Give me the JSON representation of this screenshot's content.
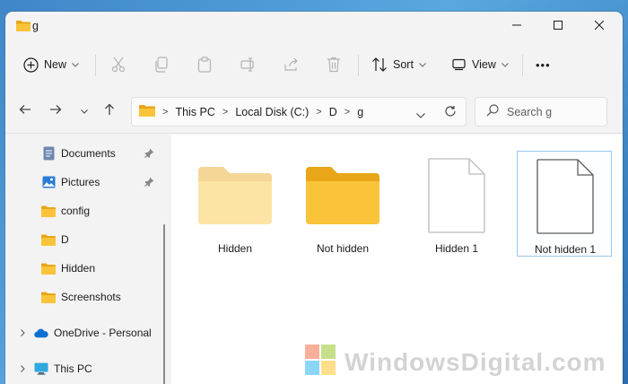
{
  "window": {
    "title": "g"
  },
  "toolbar": {
    "new_label": "New",
    "sort_label": "Sort",
    "view_label": "View",
    "more_label": "•••"
  },
  "address": {
    "crumbs": [
      "This PC",
      "Local Disk (C:)",
      "D",
      "g"
    ]
  },
  "search": {
    "placeholder": "Search g"
  },
  "sidebar": {
    "items": [
      {
        "label": "Documents",
        "icon": "documents-icon",
        "pinned": true
      },
      {
        "label": "Pictures",
        "icon": "pictures-icon",
        "pinned": true
      },
      {
        "label": "config",
        "icon": "folder-icon"
      },
      {
        "label": "D",
        "icon": "folder-icon"
      },
      {
        "label": "Hidden",
        "icon": "folder-icon"
      },
      {
        "label": "Screenshots",
        "icon": "folder-icon"
      },
      {
        "label": "OneDrive - Personal",
        "icon": "onedrive-icon",
        "expandable": true
      },
      {
        "label": "This PC",
        "icon": "this-pc-icon",
        "expandable": true
      }
    ]
  },
  "files": [
    {
      "name": "Hidden",
      "type": "folder",
      "hidden": true
    },
    {
      "name": "Not hidden",
      "type": "folder",
      "hidden": false
    },
    {
      "name": "Hidden 1",
      "type": "file",
      "hidden": true
    },
    {
      "name": "Not hidden 1",
      "type": "file",
      "hidden": false,
      "selected": true
    }
  ],
  "watermark": {
    "text": "WindowsDigital.com"
  },
  "colors": {
    "folder_yellow": "#f9c43a",
    "folder_back": "#e8a618",
    "accent_blue": "#0067c0",
    "selection_border": "#99c9ef"
  }
}
